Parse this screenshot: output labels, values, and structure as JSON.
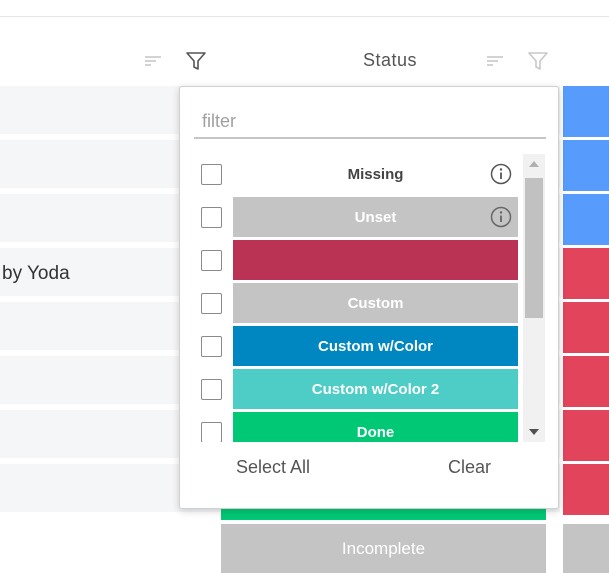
{
  "header": {
    "column_title": "Status"
  },
  "rows": [
    {
      "text": ""
    },
    {
      "text": ""
    },
    {
      "text": ""
    },
    {
      "text": "by Yoda"
    },
    {
      "text": ""
    },
    {
      "text": ""
    },
    {
      "text": ""
    },
    {
      "text": ""
    }
  ],
  "status_strip_colors": [
    "#579bfc",
    "#579bfc",
    "#579bfc",
    "#e2445c",
    "#e2445c",
    "#e2445c",
    "#e2445c",
    "#e2445c"
  ],
  "bottom_cell": {
    "label": "Incomplete",
    "color": "#c4c4c4"
  },
  "bottom_green_color": "#00c875",
  "filter_popup": {
    "placeholder": "filter",
    "value": "",
    "options": [
      {
        "label": "Missing",
        "color": "",
        "info": true
      },
      {
        "label": "Unset",
        "color": "#c4c4c4",
        "info": true
      },
      {
        "label": "",
        "color": "#bb3354",
        "info": false
      },
      {
        "label": "Custom",
        "color": "#c4c4c4",
        "info": false
      },
      {
        "label": "Custom w/Color",
        "color": "#0086c0",
        "info": false
      },
      {
        "label": "Custom w/Color 2",
        "color": "#4eccc6",
        "info": false
      },
      {
        "label": "Done",
        "color": "#00c875",
        "info": false
      }
    ],
    "select_all_label": "Select All",
    "clear_label": "Clear"
  },
  "icons": {
    "sort": "sort-icon",
    "filter": "filter-icon",
    "info": "info-icon"
  }
}
